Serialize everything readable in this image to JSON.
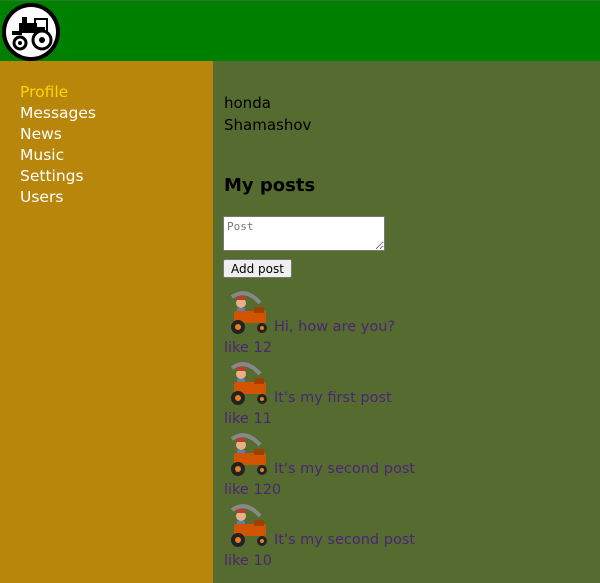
{
  "header": {
    "logo_icon": "tractor-logo-icon"
  },
  "nav": {
    "items": [
      {
        "label": "Profile",
        "active": true
      },
      {
        "label": "Messages",
        "active": false
      },
      {
        "label": "News",
        "active": false
      },
      {
        "label": "Music",
        "active": false
      },
      {
        "label": "Settings",
        "active": false
      },
      {
        "label": "Users",
        "active": false
      }
    ]
  },
  "profile": {
    "first_name": "honda",
    "last_name": "Shamashov"
  },
  "posts_section": {
    "title": "My posts",
    "input_placeholder": "Post",
    "add_button_label": "Add post",
    "posts": [
      {
        "message": "Hi, how are you?",
        "likes": "like 12",
        "avatar_icon": "tractor-avatar-icon"
      },
      {
        "message": "It's my first post",
        "likes": "like 11",
        "avatar_icon": "tractor-avatar-icon"
      },
      {
        "message": "It's my second post",
        "likes": "like 120",
        "avatar_icon": "tractor-avatar-icon"
      },
      {
        "message": "It's my second post",
        "likes": "like 10",
        "avatar_icon": "tractor-avatar-icon"
      }
    ]
  },
  "colors": {
    "header_bg": "#008000",
    "sidebar_bg": "#b8860b",
    "content_bg": "#556b2f",
    "active_nav": "#ffd700",
    "post_text": "#4b2575"
  }
}
